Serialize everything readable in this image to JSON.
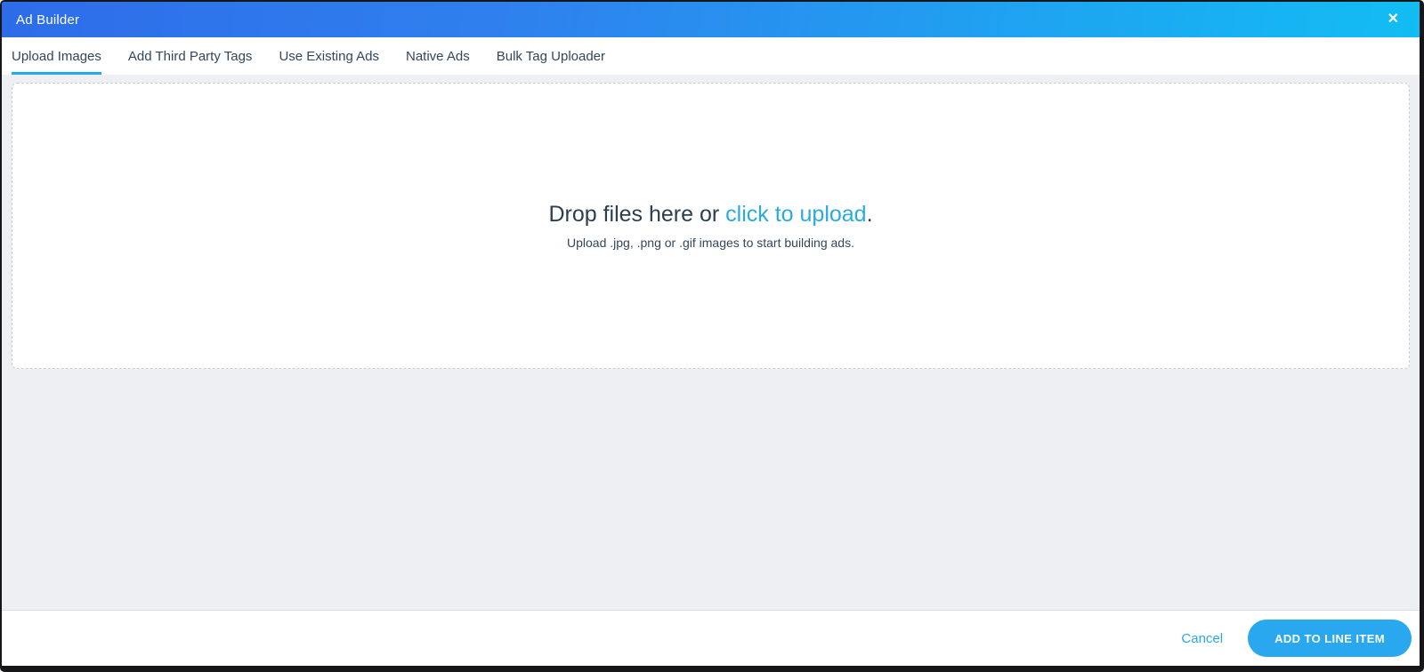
{
  "header": {
    "title": "Ad Builder",
    "close_icon": "✕"
  },
  "tabs": [
    {
      "label": "Upload Images",
      "active": true
    },
    {
      "label": "Add Third Party Tags",
      "active": false
    },
    {
      "label": "Use Existing Ads",
      "active": false
    },
    {
      "label": "Native Ads",
      "active": false
    },
    {
      "label": "Bulk Tag Uploader",
      "active": false
    }
  ],
  "dropzone": {
    "headline_prefix": "Drop files here or ",
    "headline_link": "click to upload",
    "headline_suffix": ".",
    "subtext": "Upload .jpg, .png or .gif images to start building ads."
  },
  "footer": {
    "cancel_label": "Cancel",
    "submit_label": "ADD TO LINE ITEM"
  },
  "colors": {
    "header_gradient_start": "#2d6ce9",
    "header_gradient_end": "#12bdf3",
    "active_tab_underline": "#1daee9",
    "link_blue": "#29abe2",
    "button_blue": "#29a8f0",
    "tab_text": "#33475b",
    "headline_text": "#2d3e50",
    "content_background": "#edeff2",
    "dashed_border": "#c7cdd4"
  }
}
